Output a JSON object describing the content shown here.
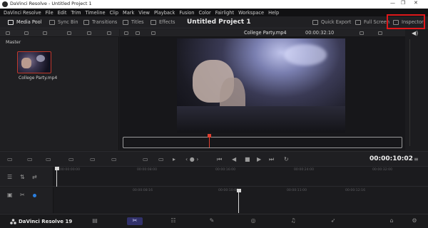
{
  "window": {
    "title": "DaVinci Resolve - Untitled Project 1"
  },
  "menu": [
    "DaVinci Resolve",
    "File",
    "Edit",
    "Trim",
    "Timeline",
    "Clip",
    "Mark",
    "View",
    "Playback",
    "Fusion",
    "Color",
    "Fairlight",
    "Workspace",
    "Help"
  ],
  "toolbar": {
    "media_pool": "Media Pool",
    "sync_bin": "Sync Bin",
    "transitions": "Transitions",
    "titles": "Titles",
    "effects": "Effects",
    "project_title": "Untitled Project 1",
    "quick_export": "Quick Export",
    "full_screen": "Full Screen",
    "inspector": "Inspector",
    "highlight_color": "#e0181b"
  },
  "media_pool": {
    "bin": "Master",
    "clips": [
      {
        "name": "College Party.mp4"
      }
    ]
  },
  "viewer": {
    "clip_name": "College Party.mp4",
    "timecode": "00:00:32:10"
  },
  "transport": {
    "timecode": "00:00:10:02"
  },
  "timeline": {
    "ruler_top": [
      "00:00:00:00",
      "00:00:08:00",
      "00:00:16:00",
      "00:00:24:00",
      "00:00:32:00"
    ],
    "ruler_bottom": [
      "00:00:08:16",
      "00:00:10:00",
      "00:00:11:00",
      "00:00:12:16"
    ]
  },
  "footer": {
    "brand": "DaVinci Resolve 19"
  }
}
